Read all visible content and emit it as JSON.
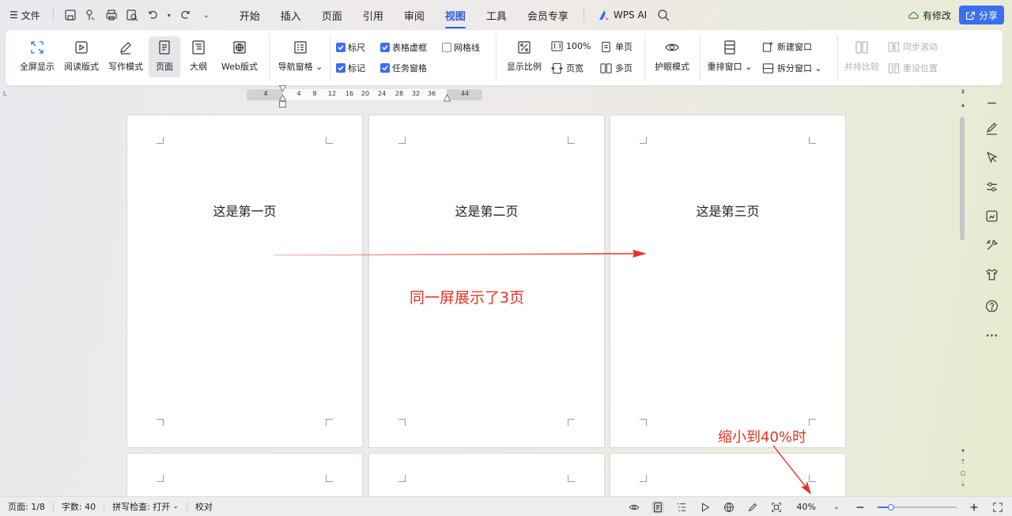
{
  "menubar": {
    "file_label": "文件",
    "tabs": [
      "开始",
      "插入",
      "页面",
      "引用",
      "审阅",
      "视图",
      "工具",
      "会员专享"
    ],
    "active_tab": "视图",
    "wps_ai_label": "WPS AI",
    "has_changes_label": "有修改",
    "share_label": "分享"
  },
  "ribbon": {
    "view_modes": [
      "全屏显示",
      "阅读版式",
      "写作模式",
      "页面",
      "大纲",
      "Web版式"
    ],
    "selected_view_mode": "页面",
    "nav_pane_label": "导航窗格",
    "checkboxes": [
      {
        "label": "标尺",
        "checked": true
      },
      {
        "label": "表格虚框",
        "checked": true
      },
      {
        "label": "网格线",
        "checked": false
      },
      {
        "label": "标记",
        "checked": true
      },
      {
        "label": "任务窗格",
        "checked": true
      }
    ],
    "zoom_label": "显示比例",
    "zoom_100_label": "100%",
    "single_page_label": "单页",
    "page_width_label": "页宽",
    "multi_page_label": "多页",
    "eye_mode_label": "护眼模式",
    "rearrange_label": "重排窗口",
    "new_window_label": "新建窗口",
    "split_window_label": "拆分窗口",
    "side_by_side_label": "并排比较",
    "sync_scroll_label": "同步滚动",
    "reset_position_label": "重设位置"
  },
  "ruler": {
    "ticks": [
      "4",
      "4",
      "8",
      "12",
      "16",
      "20",
      "24",
      "28",
      "32",
      "36",
      "44"
    ]
  },
  "pages": [
    {
      "text": "这是第一页"
    },
    {
      "text": "这是第二页"
    },
    {
      "text": "这是第三页"
    }
  ],
  "annotations": {
    "three_pages": "同一屏展示了3页",
    "zoom_note": "缩小到40%时",
    "color": "#e53326"
  },
  "statusbar": {
    "page_label": "页面: 1/8",
    "word_count_label": "字数: 40",
    "spell_check_label": "拼写检查: 打开",
    "proofread_label": "校对",
    "zoom_value": "40%",
    "zoom_level": 0.4
  }
}
